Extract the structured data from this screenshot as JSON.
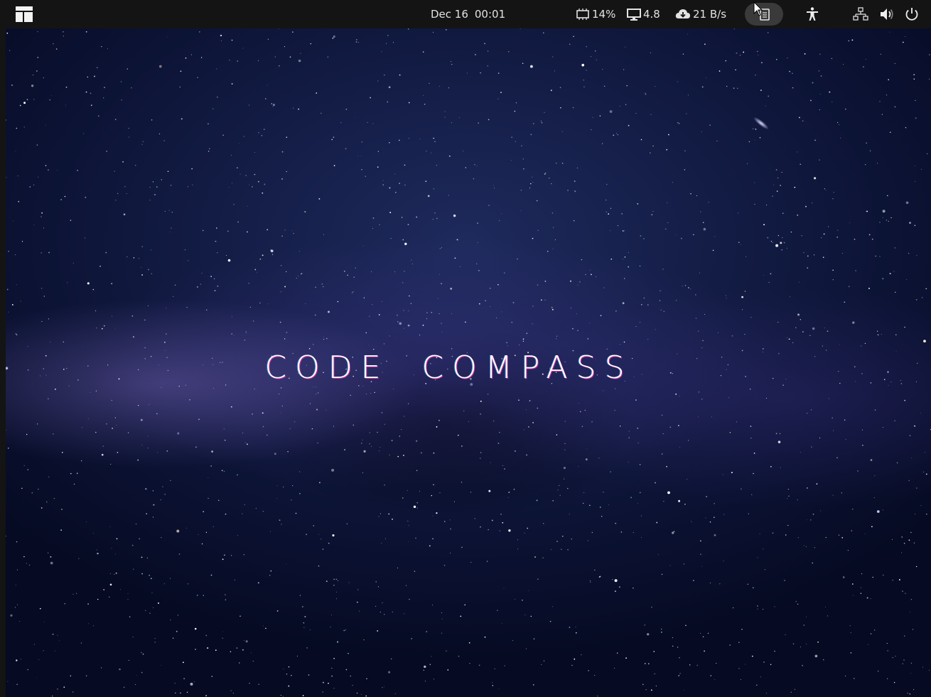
{
  "topbar": {
    "activities_icon": "activities-grid-icon",
    "clock": {
      "date": "Dec 16",
      "time": "00:01"
    },
    "system_monitor": {
      "cpu": {
        "icon": "cpu-chip-icon",
        "value": "14%"
      },
      "load": {
        "icon": "monitor-icon",
        "value": "4.8"
      },
      "network": {
        "icon": "cloud-download-icon",
        "value": "21 B/s"
      }
    },
    "indicators": [
      "clipboard-indicator-icon",
      "accessibility-icon",
      "network-wired-icon",
      "volume-icon",
      "power-icon"
    ]
  },
  "desktop": {
    "wallpaper": "starry-night-milky-way",
    "title_words": [
      "CODE",
      "COMPASS"
    ]
  },
  "colors": {
    "topbar_bg": "#141414",
    "sky_deep": "#0b1233",
    "title_text": "#ffffff",
    "title_glow_magenta": "#e632a0"
  }
}
